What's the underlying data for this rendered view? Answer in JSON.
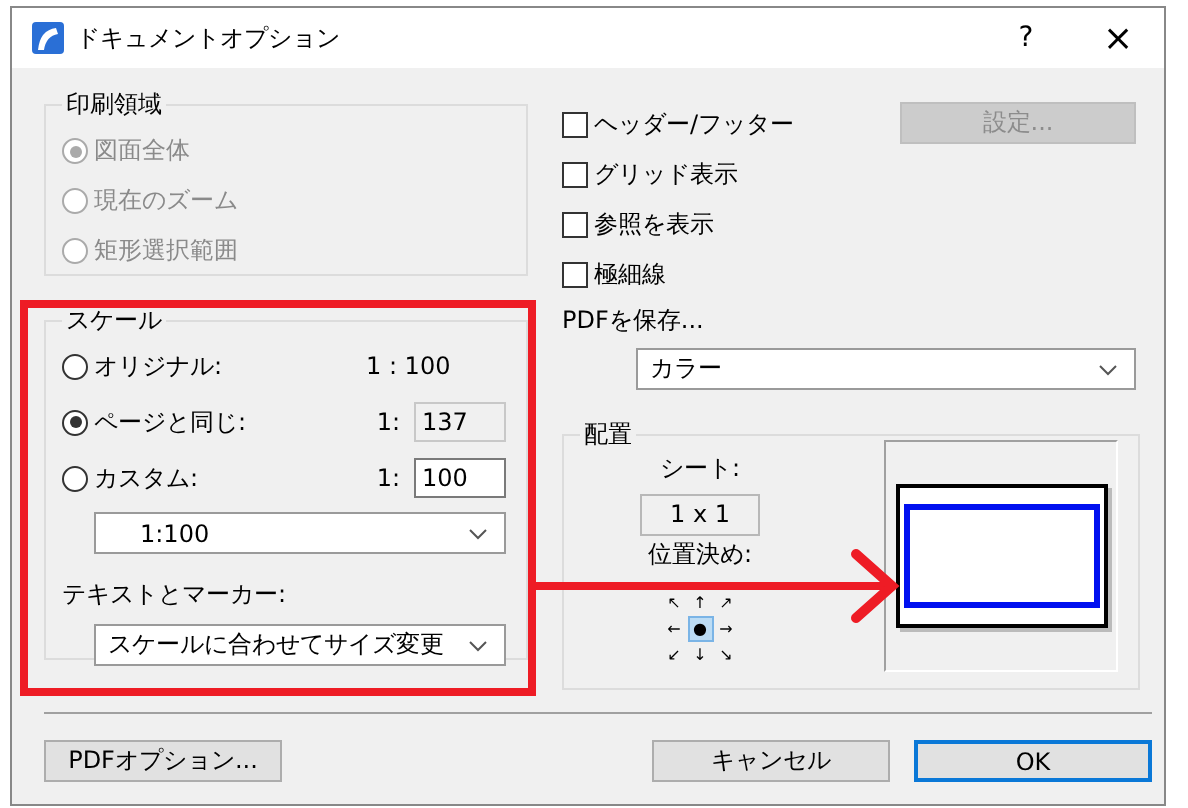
{
  "window": {
    "title": "ドキュメントオプション",
    "help": "?",
    "close": "×"
  },
  "print_area": {
    "title": "印刷領域",
    "options": [
      {
        "label": "図面全体",
        "selected": true,
        "disabled": true
      },
      {
        "label": "現在のズーム",
        "selected": false,
        "disabled": true
      },
      {
        "label": "矩形選択範囲",
        "selected": false,
        "disabled": true
      }
    ]
  },
  "checkboxes": [
    {
      "label": "ヘッダー/フッター",
      "checked": false
    },
    {
      "label": "グリッド表示",
      "checked": false
    },
    {
      "label": "参照を表示",
      "checked": false
    },
    {
      "label": "極細線",
      "checked": false
    }
  ],
  "settings_button": {
    "label": "設定...",
    "disabled": true
  },
  "scale": {
    "title": "スケール",
    "options": [
      {
        "kind": "fixed",
        "label": "オリジナル:",
        "selected": false,
        "value": "1 : 100"
      },
      {
        "kind": "readonly",
        "label": "ページと同じ:",
        "selected": true,
        "ratio": "1:",
        "value": "137"
      },
      {
        "kind": "field",
        "label": "カスタム:",
        "selected": false,
        "ratio": "1:",
        "value": "100"
      }
    ],
    "scale_dropdown": "1:100",
    "text_label": "テキストとマーカー:",
    "text_dropdown": "スケールに合わせてサイズ変更"
  },
  "save_pdf": {
    "label": "PDFを保存...",
    "dropdown": "カラー"
  },
  "layout": {
    "title": "配置",
    "sheet_label": "シート:",
    "sheet_value": "1 x 1",
    "position_label": "位置決め:",
    "positions": [
      {
        "glyph": "↖",
        "selected": false
      },
      {
        "glyph": "↑",
        "selected": false
      },
      {
        "glyph": "↗",
        "selected": false
      },
      {
        "glyph": "←",
        "selected": false
      },
      {
        "glyph": "●",
        "selected": true
      },
      {
        "glyph": "→",
        "selected": false
      },
      {
        "glyph": "↙",
        "selected": false
      },
      {
        "glyph": "↓",
        "selected": false
      },
      {
        "glyph": "↘",
        "selected": false
      }
    ]
  },
  "buttons": [
    {
      "label": "PDFオプション...",
      "kind": "left"
    },
    {
      "label": "キャンセル",
      "kind": "right"
    },
    {
      "label": "OK",
      "kind": "default"
    }
  ]
}
